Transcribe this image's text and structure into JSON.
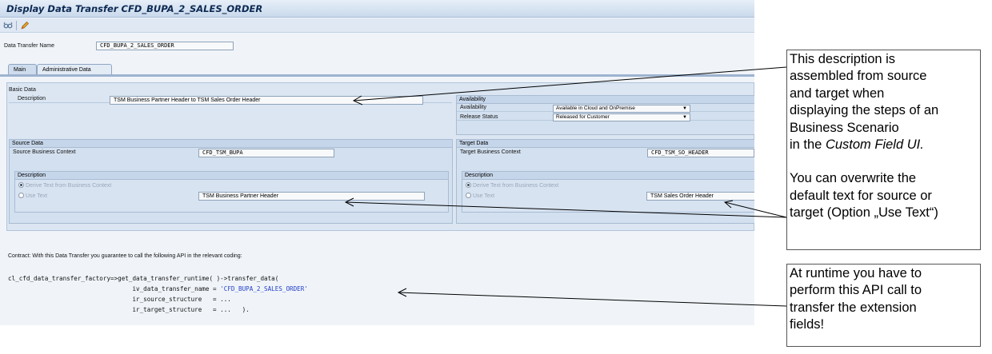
{
  "window": {
    "title": "Display Data Transfer CFD_BUPA_2_SALES_ORDER"
  },
  "toolbar": {
    "icons": [
      "glasses-icon",
      "pencil-icon"
    ]
  },
  "header": {
    "name_label": "Data Transfer Name",
    "name_value": "CFD_BUPA_2_SALES_ORDER"
  },
  "tabs": [
    {
      "label": "Main",
      "active": true
    },
    {
      "label": "Administrative Data",
      "active": false
    }
  ],
  "basic_data": {
    "title": "Basic Data",
    "description_label": "Description",
    "description_value": "TSM Business Partner Header to TSM Sales Order Header"
  },
  "availability": {
    "title": "Availability",
    "availability_label": "Availability",
    "availability_value": "Available in Cloud and OnPremise",
    "release_label": "Release Status",
    "release_value": "Released for Customer"
  },
  "source": {
    "title": "Source Data",
    "context_label": "Source Business Context",
    "context_value": "CFD_TSM_BUPA",
    "desc_title": "Description",
    "radio_derive": "Derive Text from Business Context",
    "radio_use": "Use Text",
    "use_text_value": "TSM Business Partner Header"
  },
  "target": {
    "title": "Target Data",
    "context_label": "Target Business Context",
    "context_value": "CFD_TSM_SO_HEADER",
    "desc_title": "Description",
    "radio_derive": "Derive Text from Business Context",
    "radio_use": "Use Text",
    "use_text_value": "TSM Sales Order Header"
  },
  "contract": {
    "text": "Contract: With this Data Transfer you guarantee to call the following API in the relevant coding:",
    "code_line1": "cl_cfd_data_transfer_factory=>get_data_transfer_runtime( )->transfer_data(",
    "code_line2_prefix": "                                  iv_data_transfer_name = ",
    "code_line2_string": "'CFD_BUPA_2_SALES_ORDER'",
    "code_line3": "                                  ir_source_structure   = ...",
    "code_line4": "                                  ir_target_structure   = ...   )."
  },
  "callouts": {
    "top_line1": "This description is",
    "top_line2": "assembled  from source",
    "top_line3": "and target when",
    "top_line4": "displaying the steps of an",
    "top_line5": "Business Scenario",
    "top_line6a": "in the ",
    "top_line6b": "Custom Field UI.",
    "top_line7": "You can overwrite the",
    "top_line8": "default text for source or",
    "top_line9": "target (Option „Use Text“)",
    "bottom_line1": "At runtime you have to",
    "bottom_line2": "perform this API call to",
    "bottom_line3": "transfer the extension",
    "bottom_line4": "fields!"
  }
}
